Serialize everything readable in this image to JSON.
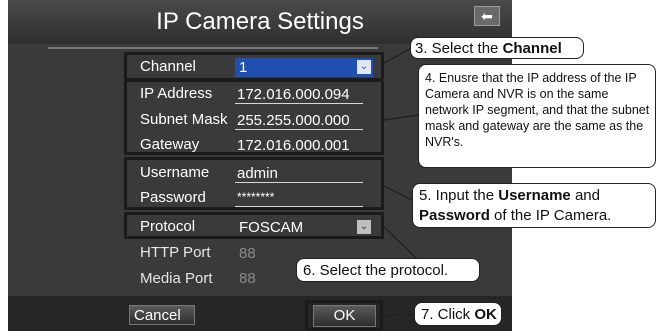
{
  "window": {
    "title": "IP Camera Settings",
    "back_icon": "back-arrow-icon",
    "back_glyph": "⬅"
  },
  "fields": {
    "channel": {
      "label": "Channel",
      "value": "1"
    },
    "ip_address": {
      "label": "IP Address",
      "value": "172.016.000.094"
    },
    "subnet_mask": {
      "label": "Subnet Mask",
      "value": "255.255.000.000"
    },
    "gateway": {
      "label": "Gateway",
      "value": "172.016.000.001"
    },
    "username": {
      "label": "Username",
      "value": "admin"
    },
    "password": {
      "label": "Password",
      "value": "********"
    },
    "protocol": {
      "label": "Protocol",
      "value": "FOSCAM"
    },
    "http_port": {
      "label": "HTTP Port",
      "value": "88"
    },
    "media_port": {
      "label": "Media Port",
      "value": "88"
    }
  },
  "buttons": {
    "cancel": "Cancel",
    "ok": "OK"
  },
  "dropdown_glyph": "⌄",
  "callouts": {
    "c3": {
      "prefix": "3. Select the ",
      "bold": "Channel"
    },
    "c4": {
      "text": "4. Enusre that the IP address of the IP Camera and NVR is on the same network IP segment, and that the subnet mask and gateway are the same as the NVR's."
    },
    "c5": {
      "prefix": "5. Input the ",
      "bold1": "Username",
      "mid": " and",
      "bold2": "Password",
      "suffix": " of the IP Camera."
    },
    "c6": {
      "text": "6. Select the protocol."
    },
    "c7": {
      "prefix": "7. Click ",
      "bold": "OK"
    }
  },
  "colors": {
    "screen_bg": "#3a3a3a",
    "selected_blue": "#1f4fb0",
    "bottom_bar": "#262626"
  }
}
